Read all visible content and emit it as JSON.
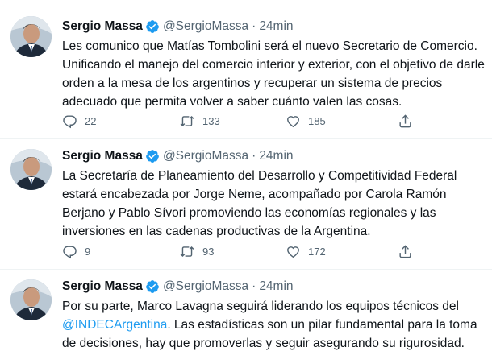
{
  "tweets": [
    {
      "name": "Sergio Massa",
      "handle": "@SergioMassa",
      "separator": "·",
      "time": "24min",
      "text": "Les comunico que Matías Tombolini será el nuevo Secretario de Comercio. Unificando el manejo del comercio interior y exterior, con el objetivo de darle orden a la mesa de los argentinos y recuperar un sistema de precios adecuado que permita volver a saber cuánto valen las cosas.",
      "replies": "22",
      "retweets": "133",
      "likes": "185"
    },
    {
      "name": "Sergio Massa",
      "handle": "@SergioMassa",
      "separator": "·",
      "time": "24min",
      "text": "La Secretaría de Planeamiento del Desarrollo y Competitividad Federal estará encabezada por Jorge Neme, acompañado por Carola Ramón Berjano y Pablo Sívori promoviendo las economías regionales y las inversiones en las cadenas productivas de la Argentina.",
      "replies": "9",
      "retweets": "93",
      "likes": "172"
    },
    {
      "name": "Sergio Massa",
      "handle": "@SergioMassa",
      "separator": "·",
      "time": "24min",
      "text_before": "Por su parte, Marco Lavagna seguirá liderando los equipos técnicos del",
      "mention": "@INDECArgentina",
      "text_after": ". Las estadísticas son un pilar fundamental para la toma de decisiones, hay que promoverlas y seguir asegurando su rigurosidad."
    }
  ],
  "icons": {
    "reply": "reply-icon",
    "retweet": "retweet-icon",
    "like": "heart-icon",
    "share": "share-icon",
    "verified": "verified-badge-icon"
  },
  "colors": {
    "text": "#0f1419",
    "secondary": "#536471",
    "link": "#1d9bf0",
    "verified": "#1d9bf0",
    "separator": "#eff3f4"
  }
}
